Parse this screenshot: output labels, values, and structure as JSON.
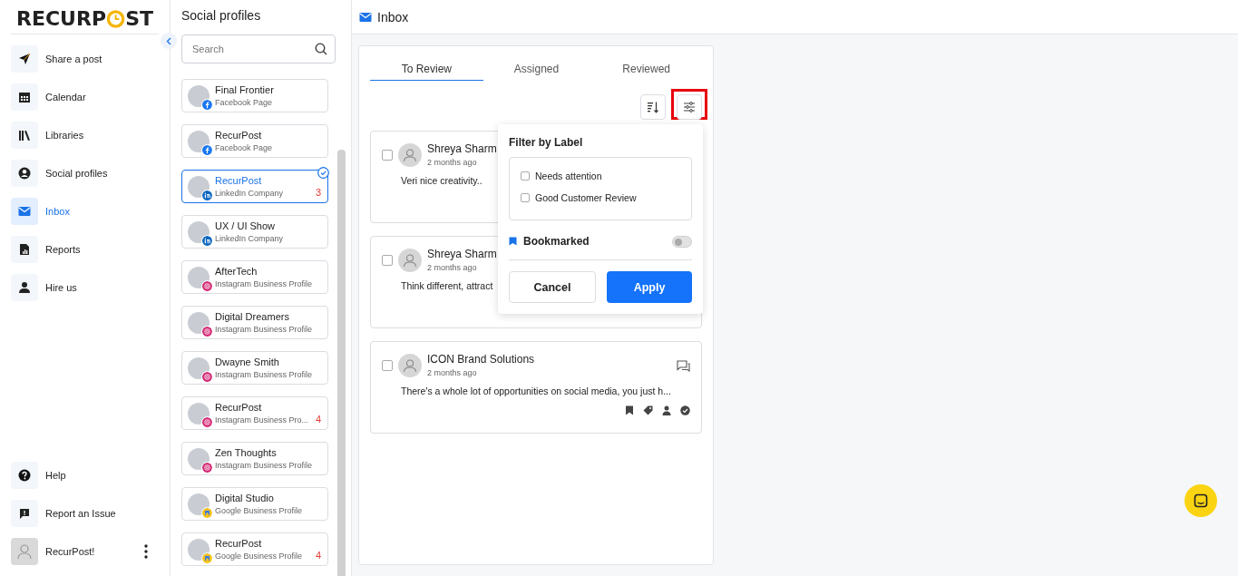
{
  "logo": {
    "before": "RECURP",
    "after": "ST"
  },
  "nav": [
    {
      "label": "Share a post",
      "selected": false
    },
    {
      "label": "Calendar",
      "selected": false
    },
    {
      "label": "Libraries",
      "selected": false
    },
    {
      "label": "Social profiles",
      "selected": false
    },
    {
      "label": "Inbox",
      "selected": true
    },
    {
      "label": "Reports",
      "selected": false
    },
    {
      "label": "Hire us",
      "selected": false
    }
  ],
  "footer_nav": [
    {
      "label": "Help"
    },
    {
      "label": "Report an Issue"
    }
  ],
  "user": {
    "name": "RecurPost!"
  },
  "profiles_panel": {
    "title": "Social profiles",
    "search": {
      "placeholder": "Search"
    },
    "profiles": [
      {
        "name": "Final Frontier",
        "type": "Facebook Page",
        "kind": "facebook",
        "selected": false
      },
      {
        "name": "RecurPost",
        "type": "Facebook Page",
        "kind": "facebook",
        "selected": false
      },
      {
        "name": "RecurPost",
        "type": "LinkedIn Company",
        "kind": "linkedin",
        "selected": true,
        "count": "3"
      },
      {
        "name": "UX / UI Show",
        "type": "LinkedIn Company",
        "kind": "linkedin",
        "selected": false
      },
      {
        "name": "AfterTech",
        "type": "Instagram Business Profile",
        "kind": "instagram",
        "selected": false
      },
      {
        "name": "Digital Dreamers",
        "type": "Instagram Business Profile",
        "kind": "instagram",
        "selected": false
      },
      {
        "name": "Dwayne Smith",
        "type": "Instagram Business Profile",
        "kind": "instagram",
        "selected": false
      },
      {
        "name": "RecurPost",
        "type": "Instagram Business Pro...",
        "kind": "instagram",
        "selected": false,
        "count": "4"
      },
      {
        "name": "Zen Thoughts",
        "type": "Instagram Business Profile",
        "kind": "instagram",
        "selected": false
      },
      {
        "name": "Digital Studio",
        "type": "Google Business Profile",
        "kind": "google",
        "selected": false
      },
      {
        "name": "RecurPost",
        "type": "Google Business Profile",
        "kind": "google",
        "selected": false,
        "count": "4"
      }
    ]
  },
  "header": {
    "title": "Inbox"
  },
  "tabs": [
    {
      "label": "To Review",
      "selected": true
    },
    {
      "label": "Assigned",
      "selected": false
    },
    {
      "label": "Reviewed",
      "selected": false
    }
  ],
  "toolbar": {
    "filter_highlighted": true
  },
  "messages": [
    {
      "author": "Shreya Sharm",
      "time": "2 months ago",
      "text": "Veri nice creativity..",
      "checked": false
    },
    {
      "author": "Shreya Sharm",
      "time": "2 months ago",
      "text": "Think different, attract",
      "checked": false
    },
    {
      "author": "ICON Brand Solutions",
      "time": "2 months ago",
      "text": "There's a whole lot of opportunities on social media, you just h...",
      "checked": false,
      "actions": true
    }
  ],
  "filter_popup": {
    "title": "Filter by Label",
    "labels": [
      {
        "label": "Needs attention",
        "checked": false
      },
      {
        "label": "Good Customer Review",
        "checked": false
      }
    ],
    "bookmarked": {
      "label": "Bookmarked",
      "on": false
    },
    "cancel": "Cancel",
    "apply": "Apply"
  }
}
